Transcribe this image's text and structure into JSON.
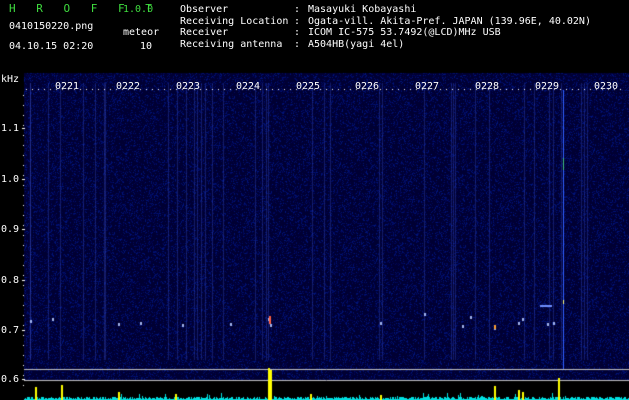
{
  "header": {
    "app_title": "H R O F F T",
    "app_version": "1.0.0",
    "filename": "0410150220.png",
    "datetime": "04.10.15 02:20",
    "meteor_label": "meteor",
    "meteor_count": "10"
  },
  "meta": [
    {
      "key": "Observer",
      "sep": ":",
      "value": "Masayuki Kobayashi"
    },
    {
      "key": "Receiving Location",
      "sep": ":",
      "value": "Ogata-vill. Akita-Pref. JAPAN (139.96E, 40.02N)"
    },
    {
      "key": "Receiver",
      "sep": ":",
      "value": "ICOM IC-575 53.7492(@LCD)MHz USB"
    },
    {
      "key": "Receiving antenna",
      "sep": ":",
      "value": "A504HB(yagi 4el)"
    }
  ],
  "spectrogram": {
    "y_unit": "kHz",
    "y_ticks": [
      "1.1",
      "1.0",
      "0.9",
      "0.8",
      "0.7",
      "0.6"
    ],
    "x_ticks": [
      "0221",
      "0222",
      "0223",
      "0224",
      "0225",
      "0226",
      "0227",
      "0228",
      "0229",
      "0230"
    ],
    "colors": {
      "background": "#000033",
      "trace": "#00e0e0",
      "meteor": "#ffff00",
      "ticks": "#ffffff",
      "baseline": "#c0c0c0"
    }
  }
}
